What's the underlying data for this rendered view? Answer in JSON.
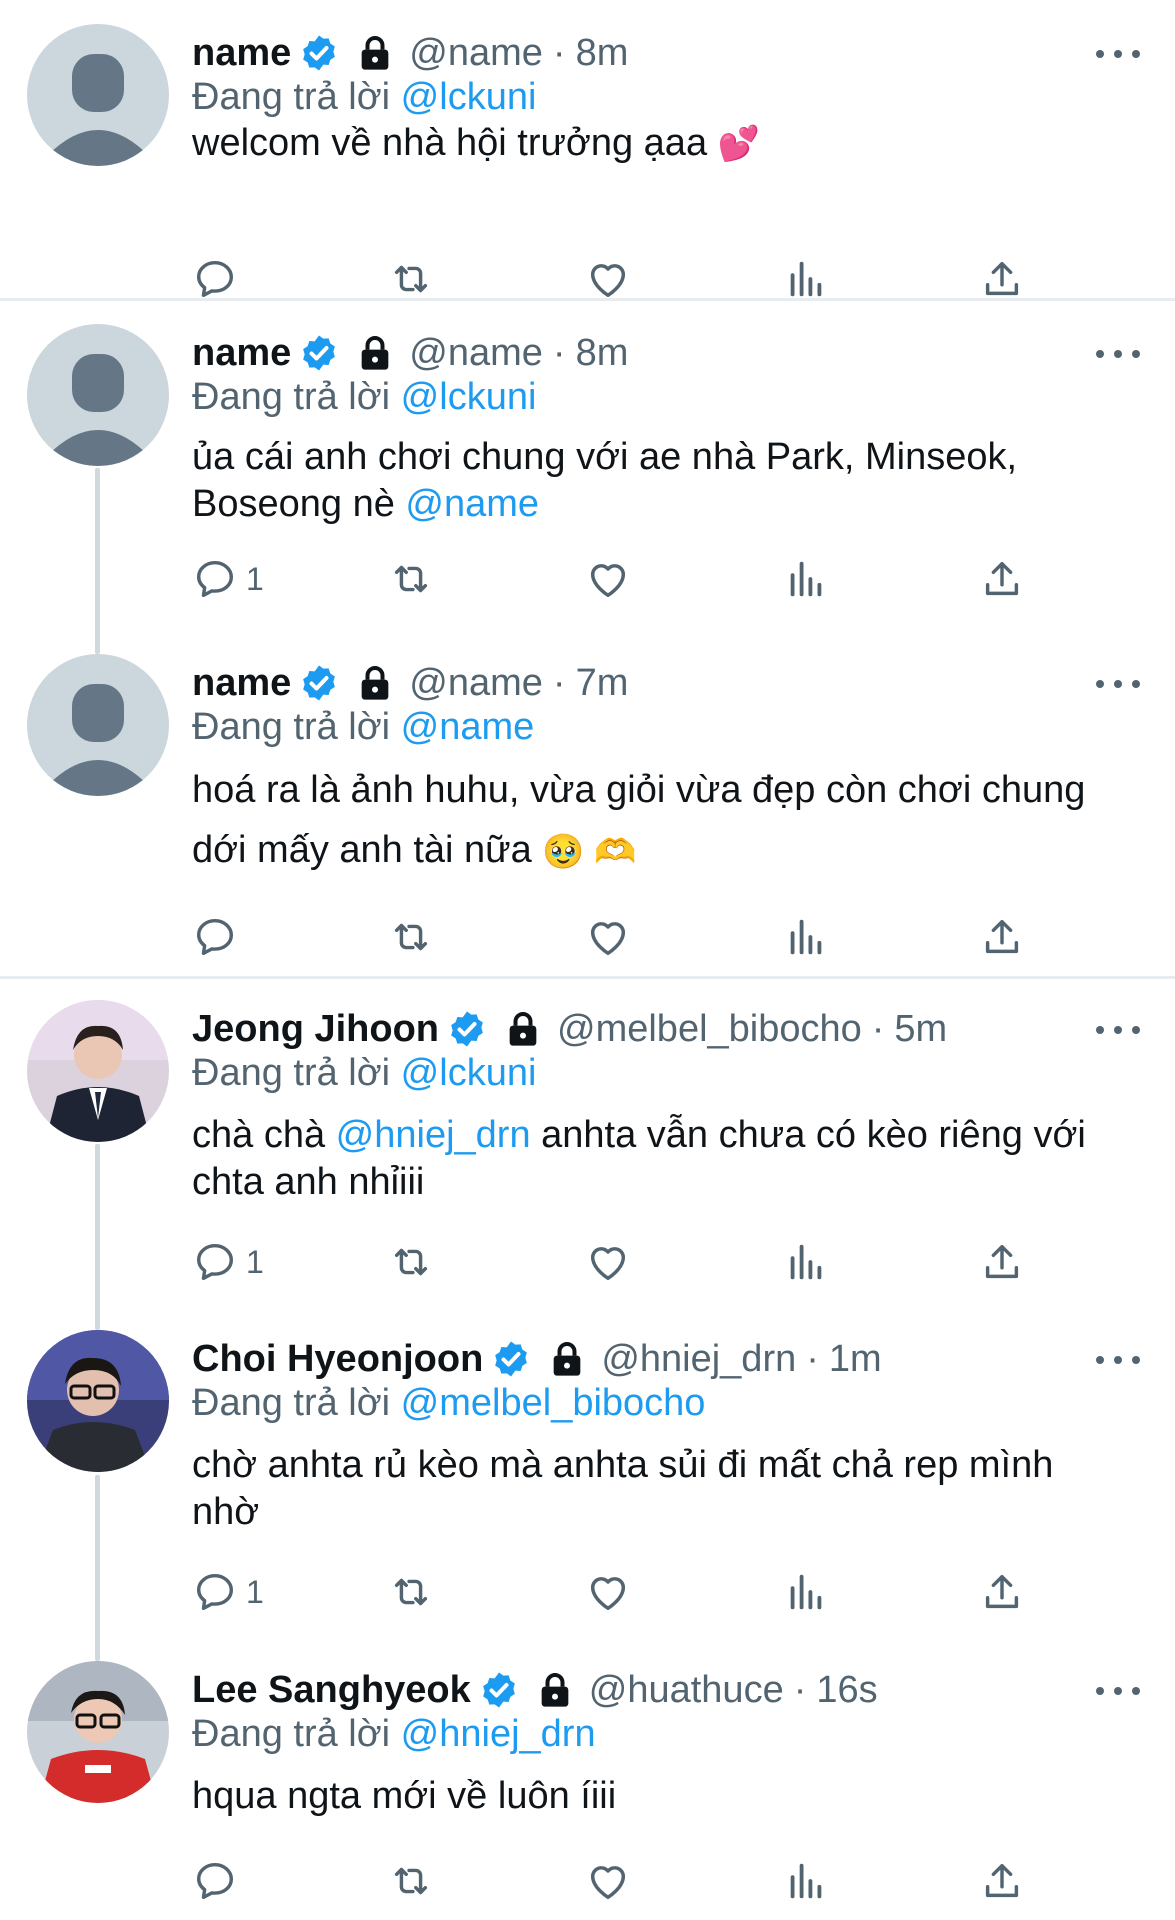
{
  "tweets": [
    {
      "name": "name",
      "handle": "@name",
      "time": "8m",
      "replying_prefix": "Đang trả lời",
      "replying_to": "@lckuni",
      "text_lines": [
        "welcom về nhà hội trưởng ạaa"
      ],
      "emoji": "💕",
      "reply_count": ""
    },
    {
      "name": "name",
      "handle": "@name",
      "time": "8m",
      "replying_prefix": "Đang trả lời",
      "replying_to": "@lckuni",
      "text_lines": [
        "ủa cái anh chơi chung với ae nhà Park, Minseok,",
        "Boseong nè"
      ],
      "inline_mention": "@name",
      "reply_count": "1"
    },
    {
      "name": "name",
      "handle": "@name",
      "time": "7m",
      "replying_prefix": "Đang trả lời",
      "replying_to": "@name",
      "text_lines": [
        "hoá ra là ảnh huhu, vừa giỏi vừa đẹp còn chơi chung",
        "dới mấy anh tài nữa"
      ],
      "emoji": "🥹 🫶",
      "reply_count": ""
    },
    {
      "name": "Jeong Jihoon",
      "handle": "@melbel_bibocho",
      "time": "5m",
      "replying_prefix": "Đang trả lời",
      "replying_to": "@lckuni",
      "text_before": "chà chà",
      "inline_mention": "@hniej_drn",
      "text_after": "anhta vẫn chưa có kèo riêng với",
      "text_line2": "chta anh nhỉiii",
      "reply_count": "1"
    },
    {
      "name": "Choi Hyeonjoon",
      "handle": "@hniej_drn",
      "time": "1m",
      "replying_prefix": "Đang trả lời",
      "replying_to": "@melbel_bibocho",
      "text_lines": [
        "chờ anhta rủ kèo mà anhta sủi đi mất chả rep mình",
        "nhờ"
      ],
      "reply_count": "1"
    },
    {
      "name": "Lee Sanghyeok",
      "handle": "@huathuce",
      "time": "16s",
      "replying_prefix": "Đang trả lời",
      "replying_to": "@hniej_drn",
      "text_lines": [
        "hqua ngta mới về luôn íiii"
      ],
      "reply_count": ""
    }
  ],
  "separator": "·",
  "icons": {
    "verified": "verified-badge-icon",
    "lock": "lock-icon",
    "more": "more-options-icon",
    "reply": "reply-icon",
    "retweet": "retweet-icon",
    "like": "like-icon",
    "views": "views-icon",
    "share": "share-icon"
  },
  "colors": {
    "accent": "#1d9bf0",
    "secondary_text": "#536471",
    "avatar_default": "#ccd6dd",
    "line": "#cfd9de"
  }
}
